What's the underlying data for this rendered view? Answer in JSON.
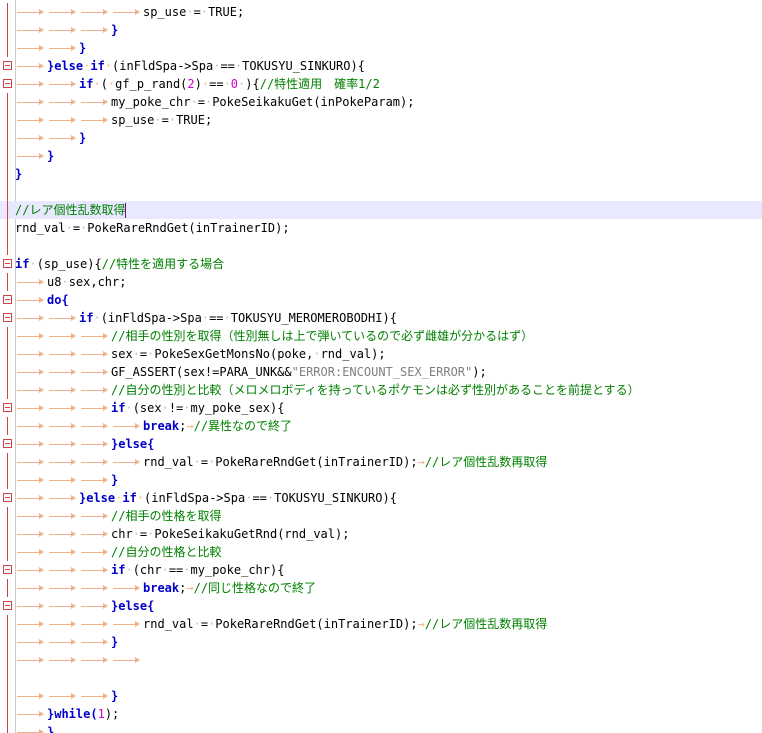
{
  "editor": {
    "current_line": 11,
    "colors": {
      "keyword": "#0000cc",
      "comment": "#008000",
      "string": "#808080",
      "number": "#d000d0",
      "whitespace_marker": "#f0b28a",
      "fold_marker": "#cc4444",
      "current_line_bg": "#e8e8ff"
    },
    "lines": [
      {
        "indent": 4,
        "tokens": [
          [
            "sp_use",
            "p"
          ],
          [
            " ",
            "s"
          ],
          [
            "=",
            "p"
          ],
          [
            " ",
            "s"
          ],
          [
            "TRUE;",
            "p"
          ]
        ]
      },
      {
        "indent": 3,
        "tokens": [
          [
            "}",
            "k"
          ]
        ]
      },
      {
        "indent": 2,
        "tokens": [
          [
            "}",
            "k"
          ]
        ]
      },
      {
        "indent": 1,
        "fold": true,
        "tokens": [
          [
            "}else",
            "k"
          ],
          [
            " ",
            "s"
          ],
          [
            "if",
            "k"
          ],
          [
            " ",
            "s"
          ],
          [
            "(inFldSpa->Spa",
            "p"
          ],
          [
            " ",
            "s"
          ],
          [
            "==",
            "p"
          ],
          [
            " ",
            "s"
          ],
          [
            "TOKUSYU_SINKURO){",
            "p"
          ]
        ]
      },
      {
        "indent": 2,
        "fold": true,
        "tokens": [
          [
            "if",
            "k"
          ],
          [
            " ",
            "s"
          ],
          [
            "(",
            "p"
          ],
          [
            " ",
            "s"
          ],
          [
            "gf_p_rand(",
            "p"
          ],
          [
            "2",
            "n"
          ],
          [
            ")",
            "p"
          ],
          [
            " ",
            "s"
          ],
          [
            "==",
            "p"
          ],
          [
            " ",
            "s"
          ],
          [
            "0",
            "n"
          ],
          [
            " ",
            "s"
          ],
          [
            "){",
            "p"
          ],
          [
            "//特性適用　確率1/2",
            "c"
          ]
        ]
      },
      {
        "indent": 3,
        "tokens": [
          [
            "my_poke_chr",
            "p"
          ],
          [
            " ",
            "s"
          ],
          [
            "=",
            "p"
          ],
          [
            " ",
            "s"
          ],
          [
            "PokeSeikakuGet(inPokeParam);",
            "p"
          ]
        ]
      },
      {
        "indent": 3,
        "tokens": [
          [
            "sp_use",
            "p"
          ],
          [
            " ",
            "s"
          ],
          [
            "=",
            "p"
          ],
          [
            " ",
            "s"
          ],
          [
            "TRUE;",
            "p"
          ]
        ]
      },
      {
        "indent": 2,
        "tokens": [
          [
            "}",
            "k"
          ]
        ]
      },
      {
        "indent": 1,
        "tokens": [
          [
            "}",
            "k"
          ]
        ]
      },
      {
        "indent": 0,
        "tokens": [
          [
            "}",
            "k"
          ]
        ]
      },
      {
        "indent": 0,
        "tokens": []
      },
      {
        "indent": 0,
        "tokens": [
          [
            "//レア個性乱数取得",
            "c"
          ]
        ],
        "cursor": true
      },
      {
        "indent": 0,
        "tokens": [
          [
            "rnd_val",
            "p"
          ],
          [
            " ",
            "s"
          ],
          [
            "=",
            "p"
          ],
          [
            " ",
            "s"
          ],
          [
            "PokeRareRndGet(inTrainerID);",
            "p"
          ]
        ]
      },
      {
        "indent": 0,
        "tokens": []
      },
      {
        "indent": 0,
        "fold": true,
        "tokens": [
          [
            "if",
            "k"
          ],
          [
            " ",
            "s"
          ],
          [
            "(sp_use){",
            "p"
          ],
          [
            "//特性を適用する場合",
            "c"
          ]
        ]
      },
      {
        "indent": 1,
        "tokens": [
          [
            "u8",
            "p"
          ],
          [
            " ",
            "s"
          ],
          [
            "sex,chr;",
            "p"
          ]
        ]
      },
      {
        "indent": 1,
        "fold": true,
        "tokens": [
          [
            "do{",
            "k"
          ]
        ]
      },
      {
        "indent": 2,
        "fold": true,
        "tokens": [
          [
            "if",
            "k"
          ],
          [
            " ",
            "s"
          ],
          [
            "(inFldSpa->Spa",
            "p"
          ],
          [
            " ",
            "s"
          ],
          [
            "==",
            "p"
          ],
          [
            " ",
            "s"
          ],
          [
            "TOKUSYU_MEROMEROBODHI){",
            "p"
          ]
        ]
      },
      {
        "indent": 3,
        "tokens": [
          [
            "//相手の性別を取得（性別無しは上で弾いているので必ず雌雄が分かるはず）",
            "c"
          ]
        ]
      },
      {
        "indent": 3,
        "tokens": [
          [
            "sex",
            "p"
          ],
          [
            " ",
            "s"
          ],
          [
            "=",
            "p"
          ],
          [
            " ",
            "s"
          ],
          [
            "PokeSexGetMonsNo(poke,",
            "p"
          ],
          [
            " ",
            "s"
          ],
          [
            "rnd_val);",
            "p"
          ]
        ]
      },
      {
        "indent": 3,
        "tokens": [
          [
            "GF_ASSERT(sex!=PARA_UNK&&",
            "p"
          ],
          [
            "\"ERROR:ENCOUNT_SEX_ERROR\"",
            "t"
          ],
          [
            ");",
            "p"
          ]
        ]
      },
      {
        "indent": 3,
        "tokens": [
          [
            "//自分の性別と比較（メロメロボディを持っているポケモンは必ず性別があることを前提とする）",
            "c"
          ]
        ]
      },
      {
        "indent": 3,
        "fold": true,
        "tokens": [
          [
            "if",
            "k"
          ],
          [
            " ",
            "s"
          ],
          [
            "(sex",
            "p"
          ],
          [
            " ",
            "s"
          ],
          [
            "!=",
            "p"
          ],
          [
            " ",
            "s"
          ],
          [
            "my_poke_sex){",
            "p"
          ]
        ]
      },
      {
        "indent": 4,
        "tokens": [
          [
            "break",
            "k"
          ],
          [
            ";",
            "p"
          ],
          [
            "TAB",
            "a"
          ],
          [
            "//異性なので終了",
            "c"
          ]
        ]
      },
      {
        "indent": 3,
        "fold": true,
        "tokens": [
          [
            "}else{",
            "k"
          ]
        ]
      },
      {
        "indent": 4,
        "tokens": [
          [
            "rnd_val",
            "p"
          ],
          [
            " ",
            "s"
          ],
          [
            "=",
            "p"
          ],
          [
            " ",
            "s"
          ],
          [
            "PokeRareRndGet(inTrainerID);",
            "p"
          ],
          [
            "TAB",
            "a"
          ],
          [
            "//レア個性乱数再取得",
            "c"
          ]
        ]
      },
      {
        "indent": 3,
        "tokens": [
          [
            "}",
            "k"
          ]
        ]
      },
      {
        "indent": 2,
        "fold": true,
        "tokens": [
          [
            "}else",
            "k"
          ],
          [
            " ",
            "s"
          ],
          [
            "if",
            "k"
          ],
          [
            " ",
            "s"
          ],
          [
            "(inFldSpa->Spa",
            "p"
          ],
          [
            " ",
            "s"
          ],
          [
            "==",
            "p"
          ],
          [
            " ",
            "s"
          ],
          [
            "TOKUSYU_SINKURO){",
            "p"
          ]
        ]
      },
      {
        "indent": 3,
        "tokens": [
          [
            "//相手の性格を取得",
            "c"
          ]
        ]
      },
      {
        "indent": 3,
        "tokens": [
          [
            "chr",
            "p"
          ],
          [
            " ",
            "s"
          ],
          [
            "=",
            "p"
          ],
          [
            " ",
            "s"
          ],
          [
            "PokeSeikakuGetRnd(rnd_val);",
            "p"
          ]
        ]
      },
      {
        "indent": 3,
        "tokens": [
          [
            "//自分の性格と比較",
            "c"
          ]
        ]
      },
      {
        "indent": 3,
        "fold": true,
        "tokens": [
          [
            "if",
            "k"
          ],
          [
            " ",
            "s"
          ],
          [
            "(chr",
            "p"
          ],
          [
            " ",
            "s"
          ],
          [
            "==",
            "p"
          ],
          [
            " ",
            "s"
          ],
          [
            "my_poke_chr){",
            "p"
          ]
        ]
      },
      {
        "indent": 4,
        "tokens": [
          [
            "break",
            "k"
          ],
          [
            ";",
            "p"
          ],
          [
            "TAB",
            "a"
          ],
          [
            "//同じ性格なので終了",
            "c"
          ]
        ]
      },
      {
        "indent": 3,
        "fold": true,
        "tokens": [
          [
            "}else{",
            "k"
          ]
        ]
      },
      {
        "indent": 4,
        "tokens": [
          [
            "rnd_val",
            "p"
          ],
          [
            " ",
            "s"
          ],
          [
            "=",
            "p"
          ],
          [
            " ",
            "s"
          ],
          [
            "PokeRareRndGet(inTrainerID);",
            "p"
          ],
          [
            "TAB",
            "a"
          ],
          [
            "//レア個性乱数再取得",
            "c"
          ]
        ]
      },
      {
        "indent": 3,
        "tokens": [
          [
            "}",
            "k"
          ]
        ]
      },
      {
        "indent": 4,
        "tokens": []
      },
      {
        "indent": 0,
        "tokens": []
      },
      {
        "indent": 3,
        "tokens": [
          [
            "}",
            "k"
          ]
        ]
      },
      {
        "indent": 1,
        "tokens": [
          [
            "}while(",
            "k"
          ],
          [
            "1",
            "n"
          ],
          [
            ");",
            "p"
          ]
        ]
      },
      {
        "indent": 1,
        "tokens": [
          [
            "}",
            "k"
          ]
        ]
      }
    ]
  }
}
